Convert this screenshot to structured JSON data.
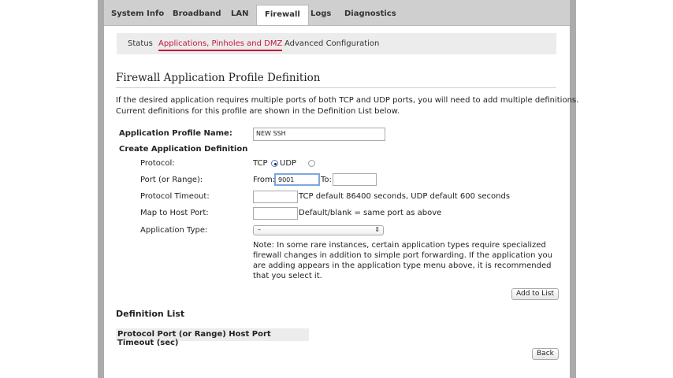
{
  "tabs": [
    {
      "label": "System Info"
    },
    {
      "label": "Broadband"
    },
    {
      "label": "LAN"
    },
    {
      "label": "Firewall",
      "active": true
    },
    {
      "label": "Logs"
    },
    {
      "label": "Diagnostics"
    }
  ],
  "subnav": [
    {
      "label": "Status"
    },
    {
      "label": "Applications, Pinholes and DMZ",
      "active": true
    },
    {
      "label": "Advanced Configuration"
    }
  ],
  "title": "Firewall Application Profile Definition",
  "intro": [
    "If the desired application requires multiple ports of both TCP and UDP ports, you will need to add multiple definitions.",
    "Current definitions for this profile are shown in the Definition List below."
  ],
  "form": {
    "profile_name_label": "Application Profile Name:",
    "profile_name_value": "NEW SSH",
    "create_heading": "Create Application Definition",
    "protocol_label": "Protocol:",
    "tcp": "TCP",
    "udp": "UDP",
    "protocol_selected": "TCP",
    "port_label": "Port (or Range):",
    "from_label": "From:",
    "from_value": "9001",
    "to_label": "To:",
    "to_value": "",
    "timeout_label": "Protocol Timeout:",
    "timeout_hint": "TCP default 86400 seconds, UDP default 600 seconds",
    "map_label": "Map to Host Port:",
    "map_hint": "Default/blank = same port as above",
    "apptype_label": "Application Type:",
    "apptype_value": "–",
    "note": "Note: In some rare instances, certain application types require specialized firewall changes in addition to simple port forwarding. If the application you are adding appears in the application type menu above, it is recommended that you select it.",
    "add_button": "Add to List"
  },
  "definition_list": {
    "heading": "Definition List",
    "header": "Protocol Port (or Range) Host Port Timeout (sec)"
  },
  "back_button": "Back",
  "colors": {
    "accent": "#c0183a",
    "frame": "#ababab"
  }
}
